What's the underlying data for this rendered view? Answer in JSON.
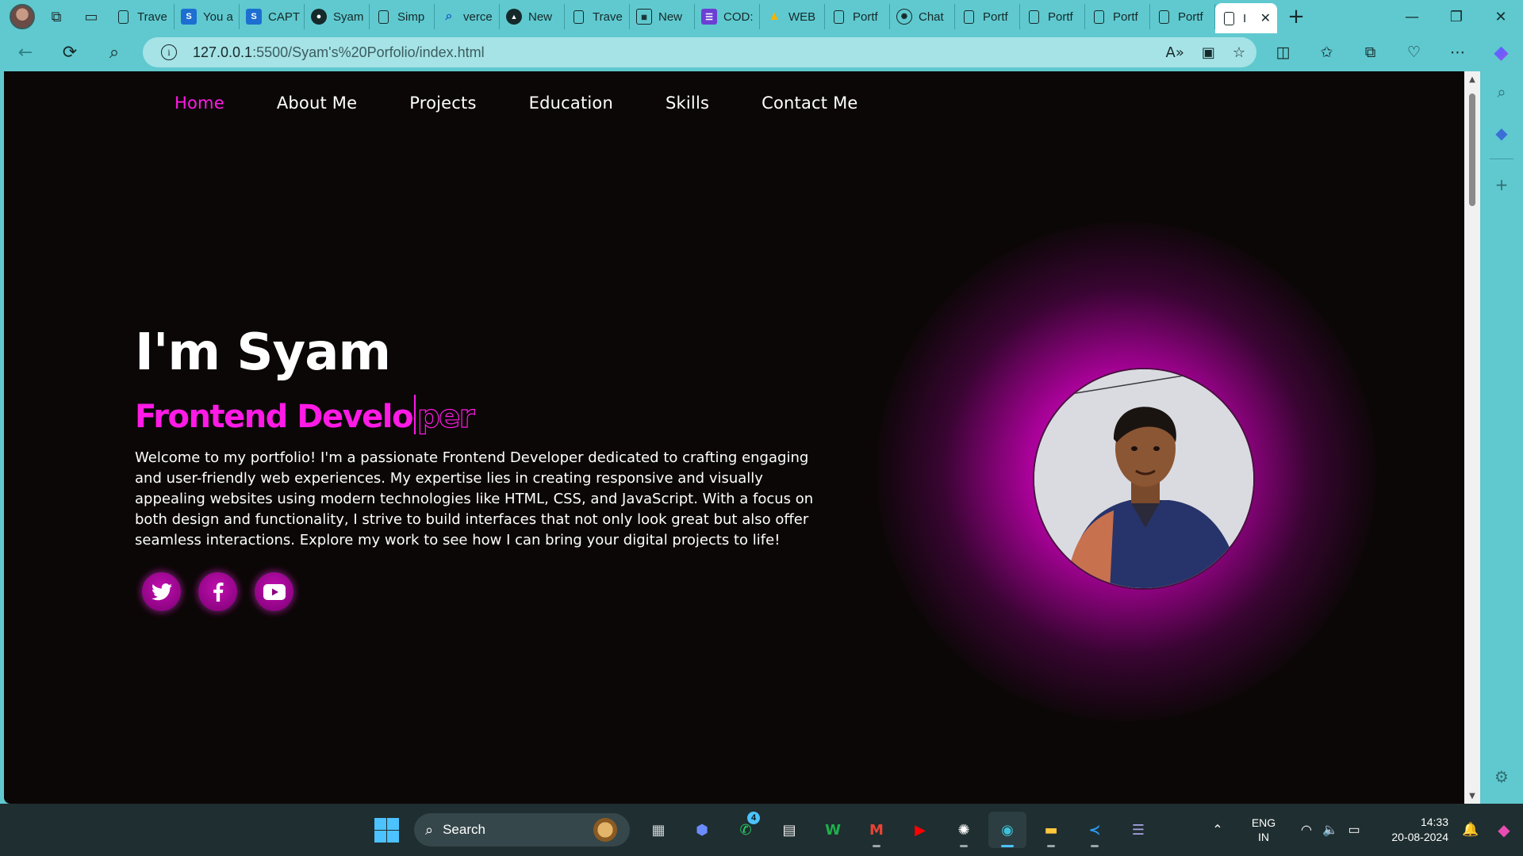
{
  "browser": {
    "tabs": [
      {
        "label": "Trave",
        "icon": "doc"
      },
      {
        "label": "You a",
        "icon": "s"
      },
      {
        "label": "CAPT",
        "icon": "s"
      },
      {
        "label": "Syam",
        "icon": "github"
      },
      {
        "label": "Simp",
        "icon": "doc"
      },
      {
        "label": "verce",
        "icon": "search"
      },
      {
        "label": "New",
        "icon": "triangle"
      },
      {
        "label": "Trave",
        "icon": "doc"
      },
      {
        "label": "New",
        "icon": "calendar"
      },
      {
        "label": "COD:",
        "icon": "list"
      },
      {
        "label": "WEB",
        "icon": "drive"
      },
      {
        "label": "Portf",
        "icon": "doc"
      },
      {
        "label": "Chat",
        "icon": "chatgpt"
      },
      {
        "label": "Portf",
        "icon": "doc"
      },
      {
        "label": "Portf",
        "icon": "doc"
      },
      {
        "label": "Portf",
        "icon": "doc"
      },
      {
        "label": "Portf",
        "icon": "doc"
      },
      {
        "label": "I",
        "icon": "doc",
        "active": true
      }
    ],
    "url": {
      "host": "127.0.0.1",
      "path": ":5500/Syam's%20Porfolio/index.html"
    },
    "accent_color": "#5fc9cf"
  },
  "site": {
    "nav": [
      {
        "label": "Home",
        "active": true
      },
      {
        "label": "About Me"
      },
      {
        "label": "Projects"
      },
      {
        "label": "Education"
      },
      {
        "label": "Skills"
      },
      {
        "label": "Contact Me"
      }
    ],
    "hero": {
      "name": "I'm Syam",
      "role_typed": "Frontend Develo",
      "role_rest": "per",
      "description": "Welcome to my portfolio! I'm a passionate Frontend Developer dedicated to crafting engaging and user-friendly web experiences. My expertise lies in creating responsive and visually appealing websites using modern technologies like HTML, CSS, and JavaScript. With a focus on both design and functionality, I strive to build interfaces that not only look great but also offer seamless interactions. Explore my work to see how I can bring your digital projects to life!"
    },
    "socials": [
      "twitter-icon",
      "facebook-icon",
      "youtube-icon"
    ],
    "accent_color": "#ff1ae6"
  },
  "taskbar": {
    "search_label": "Search",
    "whatsapp_badge": "4",
    "lang_line1": "ENG",
    "lang_line2": "IN",
    "time": "14:33",
    "date": "20-08-2024"
  }
}
